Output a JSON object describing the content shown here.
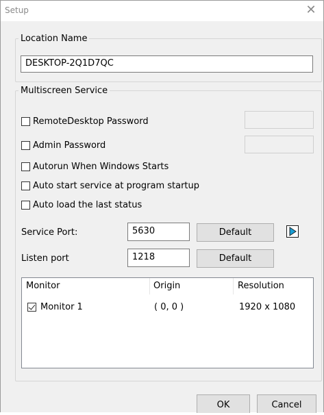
{
  "window": {
    "title": "Setup",
    "close_glyph": "✕"
  },
  "location": {
    "legend": "Location Name",
    "value": "DESKTOP-2Q1D7QC"
  },
  "multiscreen": {
    "legend": "Multiscreen Service",
    "options": [
      {
        "label": "RemoteDesktop Password",
        "checked": false
      },
      {
        "label": "Admin Password",
        "checked": false
      },
      {
        "label": "Autorun When Windows Starts",
        "checked": false
      },
      {
        "label": "Auto start service at program startup",
        "checked": false
      },
      {
        "label": "Auto load the last status",
        "checked": false
      }
    ],
    "service_port_label": "Service Port:",
    "service_port_value": "5630",
    "listen_port_label": "Listen port",
    "listen_port_value": "1218",
    "default_label": "Default",
    "accent_color": "#1a9fd6"
  },
  "monitors": {
    "columns": [
      "Monitor",
      "Origin",
      "Resolution"
    ],
    "rows": [
      {
        "name": "Monitor 1",
        "checked": true,
        "origin": "( 0, 0 )",
        "resolution": "1920 x 1080"
      }
    ]
  },
  "footer": {
    "ok_label": "OK",
    "cancel_label": "Cancel"
  }
}
